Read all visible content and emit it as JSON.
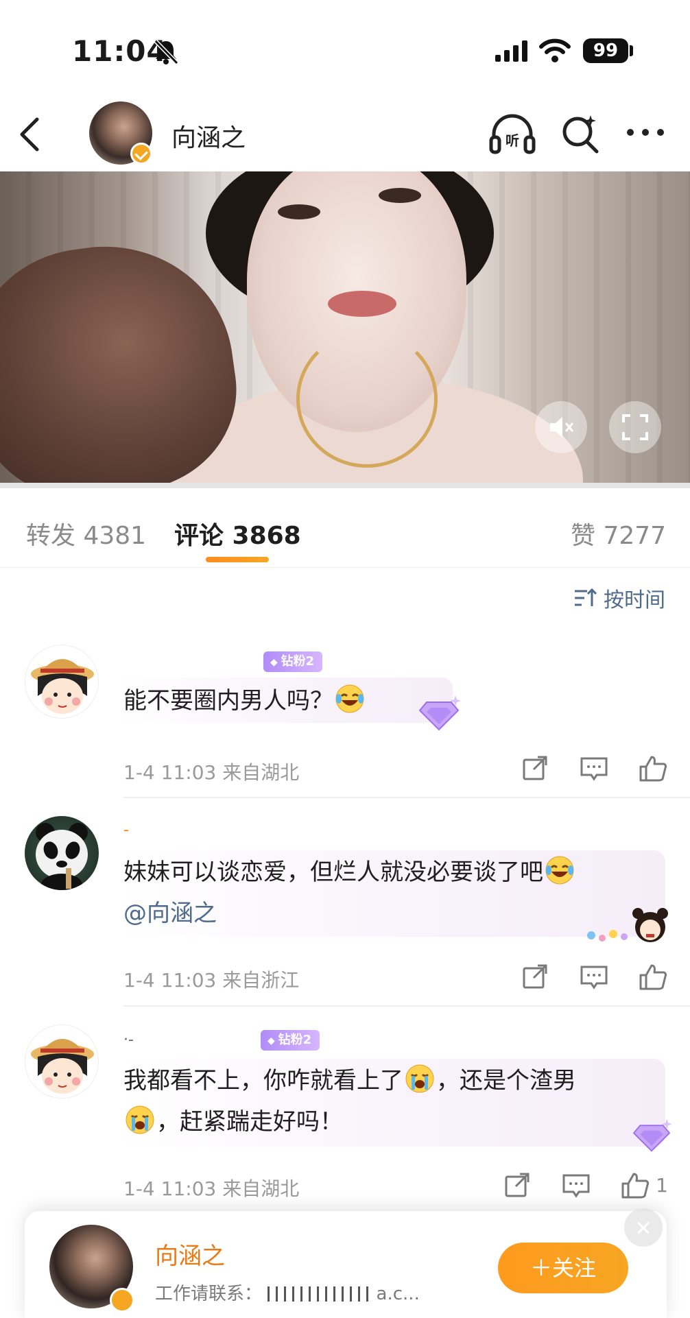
{
  "status_bar": {
    "time": "11:04",
    "battery": "99"
  },
  "header": {
    "name": "向涵之"
  },
  "tabs": [
    {
      "label": "转发 4381"
    },
    {
      "label": "评论 3868"
    },
    {
      "label": "赞 7277"
    }
  ],
  "sort": {
    "label": "按时间"
  },
  "comments": [
    {
      "badge": "钻粉2",
      "nick": "",
      "text": "能不要圈内男人吗？",
      "emojis": [
        "laughing-tears-emoji"
      ],
      "time": "1-4 11:03",
      "location": "来自湖北",
      "likes": ""
    },
    {
      "badge": "",
      "nick": "-",
      "text": "妹妹可以谈恋爱，但烂人就没必要谈了吧",
      "mention": "@向涵之",
      "emojis": [
        "laughing-tears-emoji"
      ],
      "time": "1-4 11:03",
      "location": "来自浙江",
      "likes": ""
    },
    {
      "badge": "钻粉2",
      "nick": "·-",
      "text_line1": "我都看不上，你咋就看上了",
      "text_line1b": "，还是个渣男",
      "text_line2": "，赶紧踹走好吗！",
      "emojis": [
        "crying-emoji",
        "crying-emoji"
      ],
      "time": "1-4 11:03",
      "location": "来自湖北",
      "likes": "1"
    }
  ],
  "follow_card": {
    "name": "向涵之",
    "desc": "工作请联系：",
    "desc_tail": "a.c...",
    "button": "＋关注"
  },
  "colors": {
    "accent": "#ff8200",
    "link": "#4e6a8d",
    "badge": "#b08cf6"
  }
}
